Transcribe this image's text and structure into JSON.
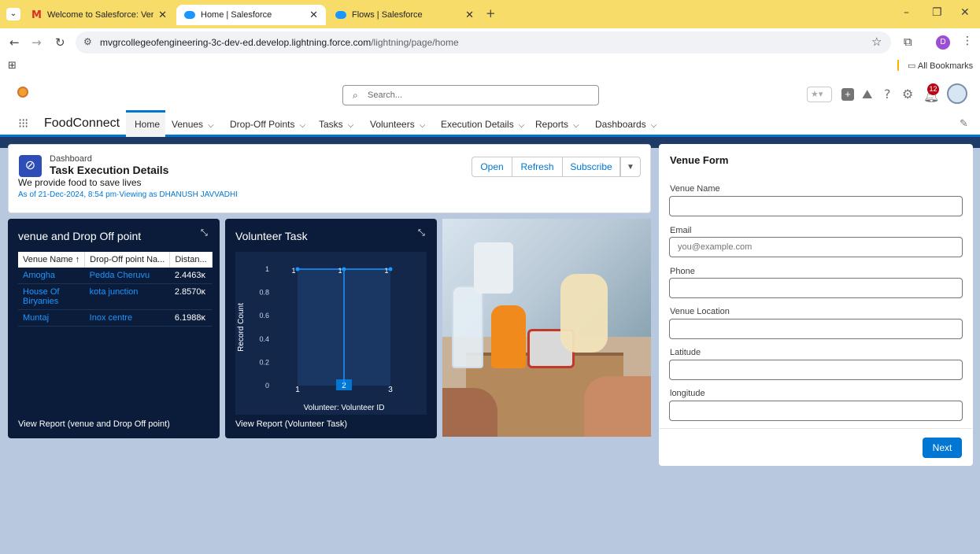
{
  "browser": {
    "tabs": [
      {
        "title": "Welcome to Salesforce: Verify y"
      },
      {
        "title": "Home | Salesforce"
      },
      {
        "title": "Flows | Salesforce"
      }
    ],
    "url_host": "mvgrcollegeofengineering-3c-dev-ed.develop.lightning.force.com",
    "url_path": "/lightning/page/home",
    "profile_initial": "D",
    "bookmarks_label": "All Bookmarks"
  },
  "header": {
    "search_placeholder": "Search...",
    "notification_count": "12"
  },
  "nav": {
    "app_name": "FoodConnect",
    "items": [
      "Home",
      "Venues",
      "Drop-Off Points",
      "Tasks",
      "Volunteers",
      "Execution Details",
      "Reports",
      "Dashboards"
    ]
  },
  "dashboard": {
    "label": "Dashboard",
    "title": "Task Execution Details",
    "description": "We provide food to save lives",
    "meta": "As of 21-Dec-2024, 8:54 pm·Viewing as DHANUSH JAVVADHI",
    "buttons": {
      "open": "Open",
      "refresh": "Refresh",
      "subscribe": "Subscribe"
    }
  },
  "widget1": {
    "title": "venue and Drop Off point",
    "columns": [
      "Venue Name ↑",
      "Drop-Off point Na...",
      "Distan..."
    ],
    "rows": [
      [
        "Amogha",
        "Pedda Cheruvu",
        "2.4463ĸ"
      ],
      [
        "House Of Biryanies",
        "kota junction",
        "2.8570ĸ"
      ],
      [
        "Muntaj",
        "Inox centre",
        "6.1988ĸ"
      ]
    ],
    "footer": "View Report (venue and Drop Off point)"
  },
  "widget2": {
    "title": "Volunteer Task",
    "footer": "View Report (Volunteer Task)"
  },
  "chart_data": {
    "type": "line",
    "title": "",
    "xlabel": "Volunteer: Volunteer ID",
    "ylabel": "Record Count",
    "x": [
      "1",
      "2",
      "3"
    ],
    "series": [
      {
        "values": [
          1,
          1,
          1
        ]
      }
    ],
    "data_labels": [
      "1",
      "1",
      "1"
    ],
    "ylim": [
      0,
      1
    ],
    "yticks": [
      "0",
      "0.2",
      "0.4",
      "0.6",
      "0.8",
      "1"
    ],
    "highlighted_x": "2"
  },
  "form": {
    "title": "Venue Form",
    "fields": [
      {
        "label": "Venue Name",
        "placeholder": ""
      },
      {
        "label": "Email",
        "placeholder": "you@example.com"
      },
      {
        "label": "Phone",
        "placeholder": ""
      },
      {
        "label": "Venue Location",
        "placeholder": ""
      },
      {
        "label": "Latitude",
        "placeholder": ""
      },
      {
        "label": "longitude",
        "placeholder": ""
      }
    ],
    "next_label": "Next"
  },
  "colors": {
    "brand": "#0176d3",
    "tabstrip": "#f8dc6a",
    "widget_bg": "#0b1c3a"
  }
}
